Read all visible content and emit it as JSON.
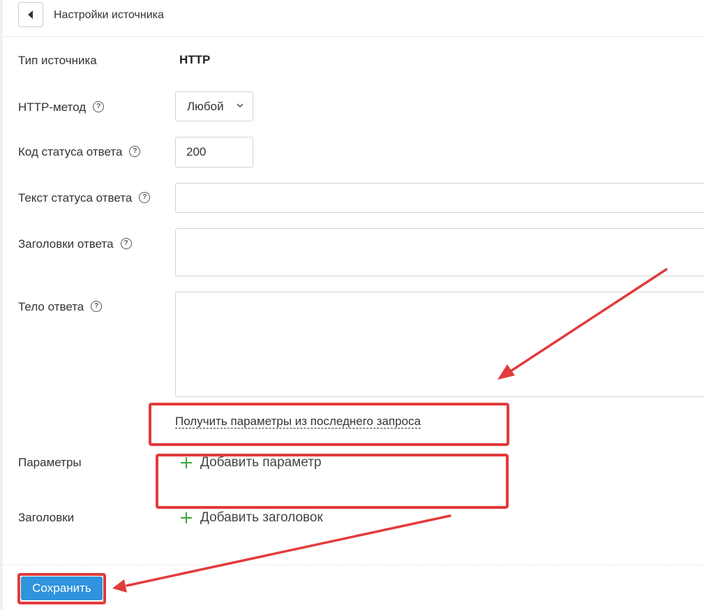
{
  "header": {
    "title": "Настройки источника",
    "back_icon": "back-arrow-icon"
  },
  "form": {
    "source_type": {
      "label": "Тип источника",
      "value": "HTTP"
    },
    "http_method": {
      "label": "HTTP-метод",
      "selected": "Любой",
      "help_icon": "question-icon"
    },
    "status_code": {
      "label": "Код статуса ответа",
      "value": "200",
      "help_icon": "question-icon"
    },
    "status_text": {
      "label": "Текст статуса ответа",
      "value": "",
      "help_icon": "question-icon"
    },
    "response_headers": {
      "label": "Заголовки ответа",
      "value": "",
      "help_icon": "question-icon"
    },
    "response_body": {
      "label": "Тело ответа",
      "value": "",
      "help_icon": "question-icon"
    },
    "fetch_link": "Получить параметры из последнего запроса",
    "params": {
      "label": "Параметры",
      "add_label": "Добавить параметр"
    },
    "headers": {
      "label": "Заголовки",
      "add_label": "Добавить заголовок"
    }
  },
  "footer": {
    "save_label": "Сохранить"
  },
  "colors": {
    "accent": "#2f93dd",
    "annotation": "#e23b3b",
    "plus": "#3aa63a"
  }
}
